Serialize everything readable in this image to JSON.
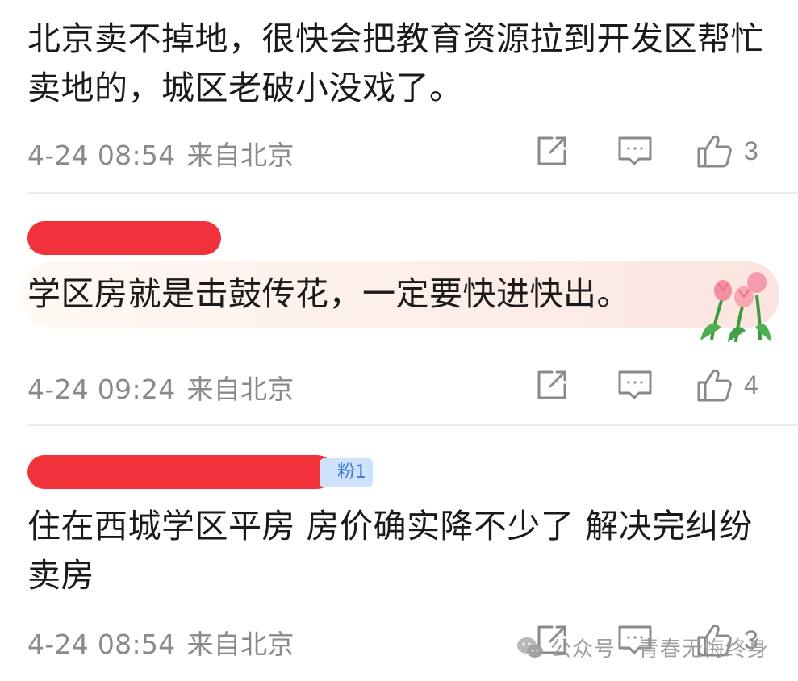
{
  "comments": [
    {
      "text": "北京卖不掉地，很快会把教育资源拉到开发区帮忙卖地的，城区老破小没戏了。",
      "time": "4-24 08:54",
      "location": "来自北京",
      "likes": "3"
    },
    {
      "name_peek": "熊",
      "text": "学区房就是击鼓传花，一定要快进快出。",
      "time": "4-24 09:24",
      "location": "来自北京",
      "likes": "4"
    },
    {
      "badge": "粉1",
      "text": "住在西城学区平房 房价确实降不少了 解决完纠纷 卖房",
      "time": "4-24 08:54",
      "location": "来自北京",
      "likes": "3"
    }
  ],
  "icons": {
    "share": "share-icon",
    "reply": "comment-icon",
    "like": "thumbs-up-icon"
  },
  "colors": {
    "redaction": "#f2323a",
    "meta_text": "#8a8a8a",
    "badge_bg": "#cfe2fb",
    "badge_text": "#3a7bd5"
  },
  "watermark": {
    "text": "公众号 · 青春无悔终身"
  }
}
